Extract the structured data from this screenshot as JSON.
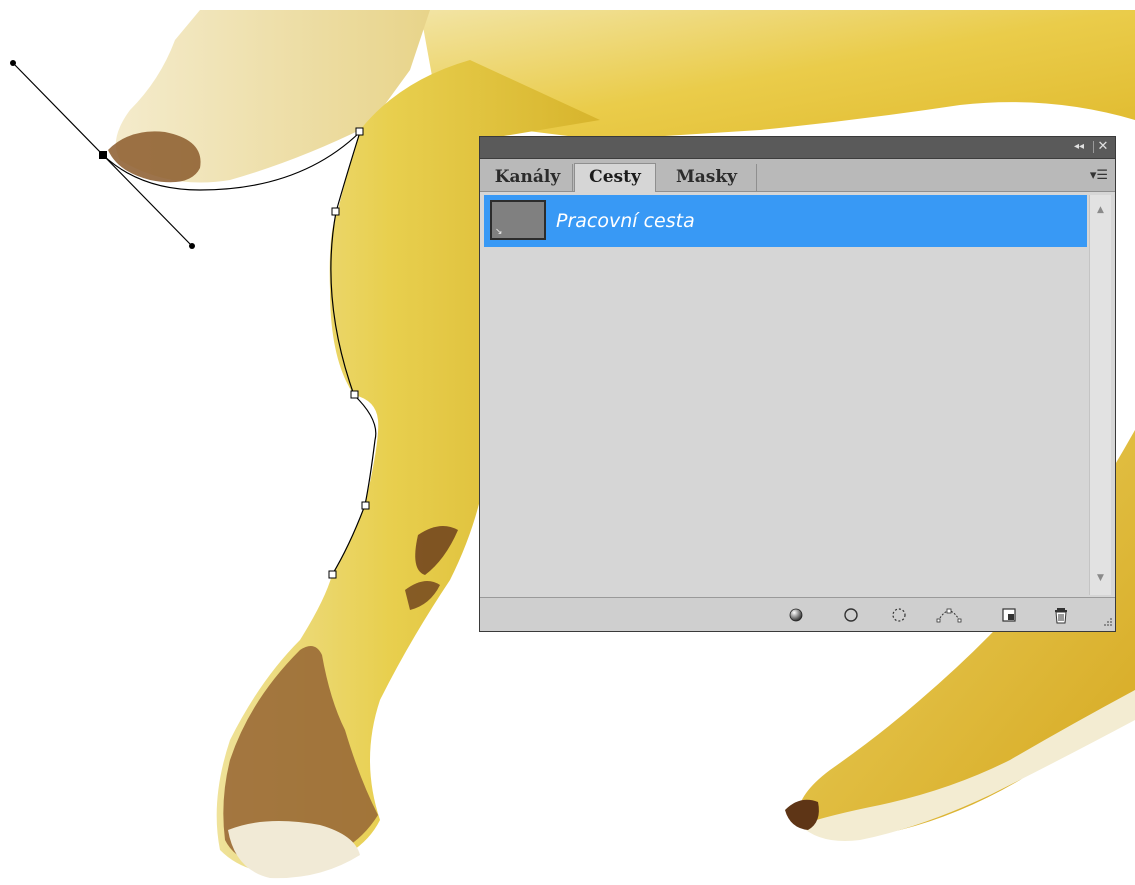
{
  "panel": {
    "tabs": [
      {
        "label": "Kanály",
        "active": false
      },
      {
        "label": "Cesty",
        "active": true
      },
      {
        "label": "Masky",
        "active": false
      }
    ],
    "paths": [
      {
        "name": "Pracovní cesta",
        "selected": true
      }
    ],
    "titlebar": {
      "collapse_icon": "double-chevron-left-icon",
      "close_icon": "close-icon"
    },
    "menu_icon": "panel-menu-icon",
    "footer_icons": [
      "fill-path-icon",
      "stroke-path-icon",
      "load-path-as-selection-icon",
      "make-work-path-icon",
      "new-path-icon",
      "delete-path-icon"
    ]
  },
  "colors": {
    "selection": "#3899f5",
    "panel_bg": "#d6d6d6",
    "titlebar_bg": "#5a5a5a",
    "banana_yellow": "#e9cf4f",
    "banana_brown": "#7a4a22"
  }
}
